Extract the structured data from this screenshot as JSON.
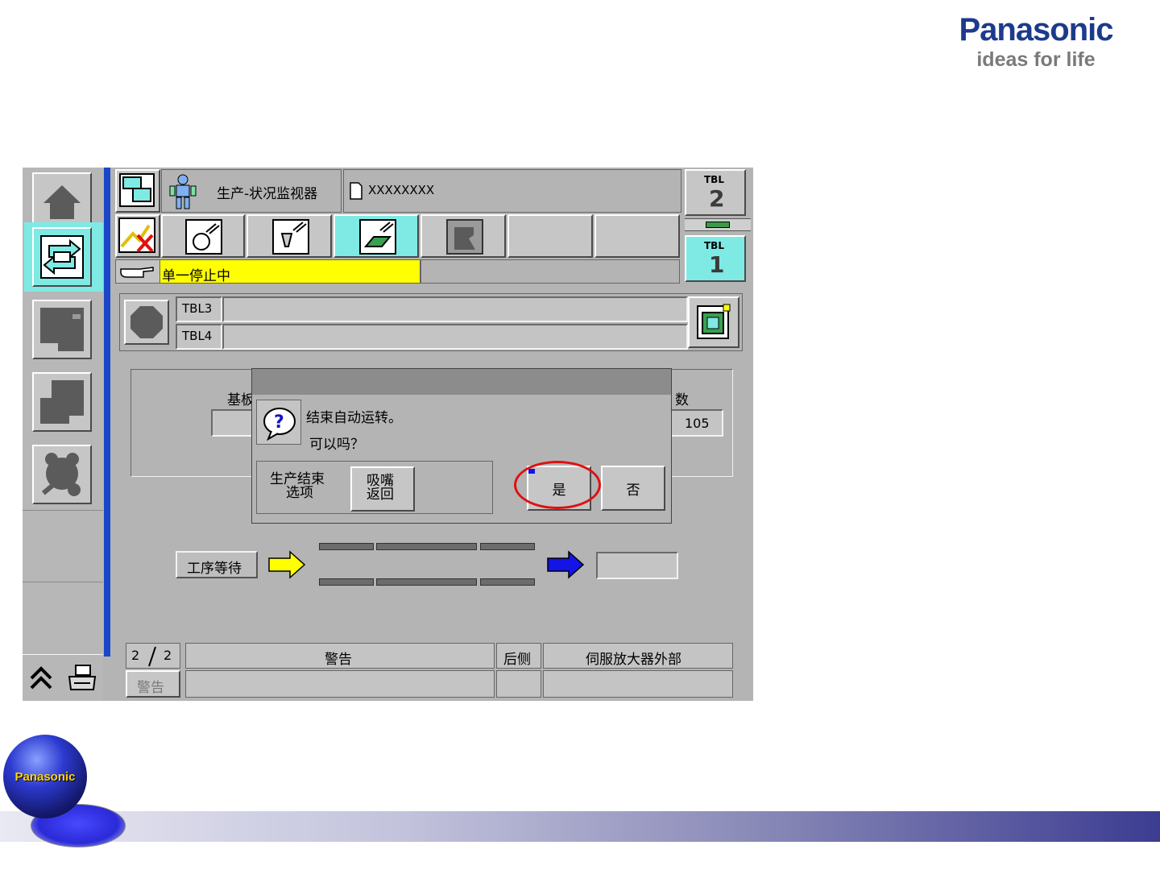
{
  "brand": {
    "name": "Panasonic",
    "tagline": "ideas for life",
    "sphere_label": "Panasonic"
  },
  "header": {
    "title": "生产-状况监视器",
    "file_name": "XXXXXXXX",
    "tbl_top": {
      "label": "TBL",
      "number": "2"
    },
    "tbl_bottom": {
      "label": "TBL",
      "number": "1"
    }
  },
  "status": {
    "message": "单一停止中"
  },
  "tables": {
    "row1": "TBL3",
    "row2": "TBL4"
  },
  "info": {
    "left_label": "基板",
    "right_label": "数",
    "right_value": "105"
  },
  "dialog": {
    "line1": "结束自动运转。",
    "line2": "可以吗？",
    "option_label_1": "生产结束",
    "option_label_2": "选项",
    "nozzle_label_1": "吸嘴",
    "nozzle_label_2": "返回",
    "yes_label": "是",
    "no_label": "否"
  },
  "flow": {
    "waiting_label": "工序等待",
    "output_value": ""
  },
  "alarm": {
    "page_current": "2",
    "page_total": "2",
    "type_header": "警告",
    "location_header": "后侧",
    "detail_header": "伺服放大器外部",
    "tab_label": "警告",
    "row_type": "",
    "row_location": "",
    "row_detail": ""
  },
  "colors": {
    "screen_bg": "#b4b4b4",
    "status_yellow": "#ffff00",
    "accent_cyan": "#7fe9e4",
    "sidebar_blue": "#1a47c9",
    "highlight_red": "#e01010",
    "arrow_yellow": "#ffff00",
    "arrow_blue": "#1414e6"
  }
}
